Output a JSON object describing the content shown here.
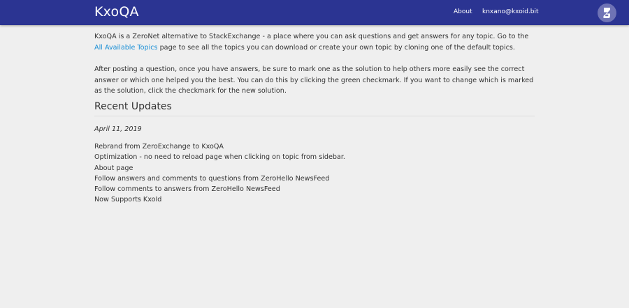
{
  "navbar": {
    "brand": "KxoQA",
    "about_label": "About",
    "user_label": "knxano@kxoid.bit",
    "zeronet_icon": "zeronet-logo-icon",
    "bg_color": "#2b3492"
  },
  "intro": {
    "p1_before_link": "KxoQA is a ZeroNet alternative to StackExchange - a place where you can ask questions and get answers for any topic. Go to the ",
    "p1_link": "All Available Topics",
    "p1_after_link": " page to see all the topics you can download or create your own topic by cloning one of the default topics.",
    "p2": "After posting a question, once you have answers, be sure to mark one as the solution to help others more easily see the correct answer or which one helped you the best. You can do this by clicking the green checkmark. If you want to change which is marked as the solution, click the checkmark for the new solution."
  },
  "updates": {
    "title": "Recent Updates",
    "date": "April 11, 2019",
    "items": [
      "Rebrand from ZeroExchange to KxoQA",
      "Optimization - no need to reload page when clicking on topic from sidebar.",
      "About page",
      "Follow answers and comments to questions from ZeroHello NewsFeed",
      "Follow comments to answers from ZeroHello NewsFeed",
      "Now Supports KxoId"
    ]
  },
  "colors": {
    "link": "#1a8fd6",
    "page_bg": "#efefef"
  }
}
